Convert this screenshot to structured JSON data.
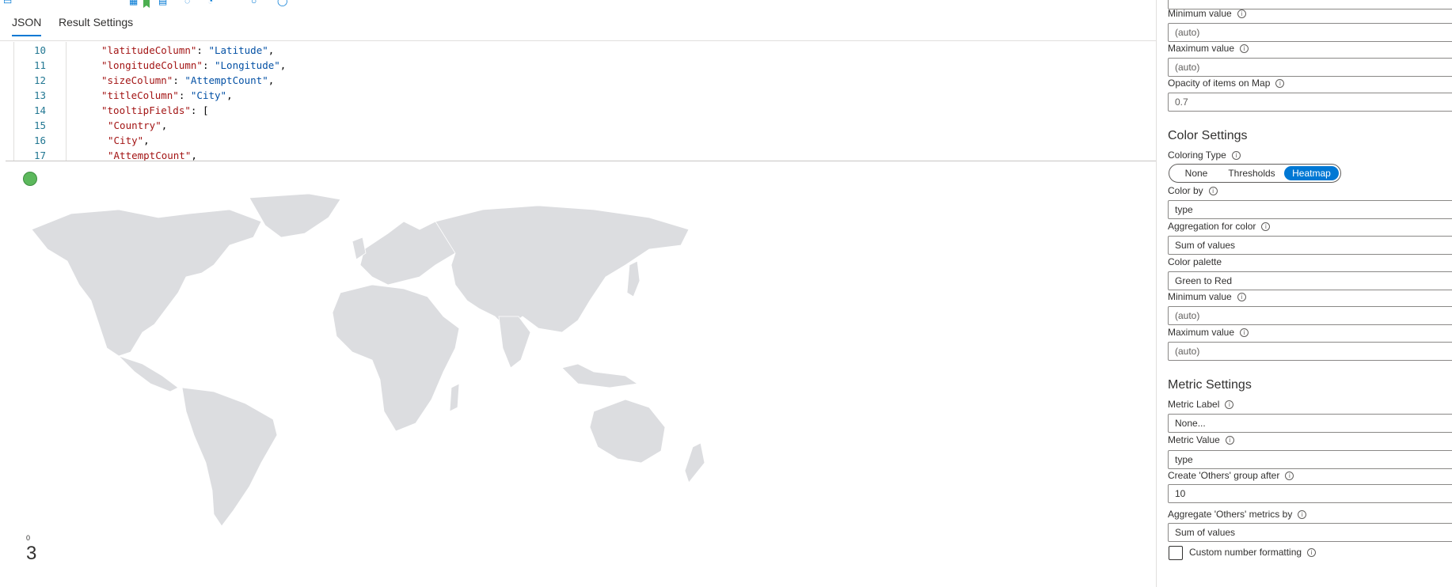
{
  "tabs": [
    "JSON",
    "Result Settings"
  ],
  "editor": {
    "lines": [
      {
        "num": "10",
        "key": "\"latitudeColumn\"",
        "value": "\"Latitude\"",
        "tail": ","
      },
      {
        "num": "11",
        "key": "\"longitudeColumn\"",
        "value": "\"Longitude\"",
        "tail": ","
      },
      {
        "num": "12",
        "key": "\"sizeColumn\"",
        "value": "\"AttemptCount\"",
        "tail": ","
      },
      {
        "num": "13",
        "key": "\"titleColumn\"",
        "value": "\"City\"",
        "tail": ","
      },
      {
        "num": "14",
        "key": "\"tooltipFields\"",
        "value": "",
        "tail": ": ["
      },
      {
        "num": "15",
        "key": "",
        "value": "\"Country\"",
        "tail": ","
      },
      {
        "num": "16",
        "key": "",
        "value": "\"City\"",
        "tail": ","
      },
      {
        "num": "17",
        "key": "",
        "value": "\"AttemptCount\"",
        "tail": ","
      }
    ]
  },
  "map_legend": {
    "small": "0",
    "big": "3"
  },
  "panel": {
    "size_min_label": "Minimum value",
    "size_min_value": "(auto)",
    "size_max_label": "Maximum value",
    "size_max_value": "(auto)",
    "opacity_label": "Opacity of items on Map",
    "opacity_value": "0.7",
    "color_section": "Color Settings",
    "coloring_type_label": "Coloring Type",
    "coloring_options": [
      "None",
      "Thresholds",
      "Heatmap"
    ],
    "coloring_selected": "Heatmap",
    "color_by_label": "Color by",
    "color_by_value": "type",
    "agg_color_label": "Aggregation for color",
    "agg_color_value": "Sum of values",
    "palette_label": "Color palette",
    "palette_value": "Green to Red",
    "color_min_label": "Minimum value",
    "color_min_value": "(auto)",
    "color_max_label": "Maximum value",
    "color_max_value": "(auto)",
    "metric_section": "Metric Settings",
    "metric_label_label": "Metric Label",
    "metric_label_value": "None...",
    "metric_value_label": "Metric Value",
    "metric_value_value": "type",
    "others_after_label": "Create 'Others' group after",
    "others_after_value": "10",
    "agg_others_label": "Aggregate 'Others' metrics by",
    "agg_others_value": "Sum of values",
    "custom_format_label": "Custom number formatting"
  },
  "icons": {
    "info": "info-circle-icon",
    "status": "status-dot-icon",
    "checkbox": "checkbox-icon"
  },
  "colors": {
    "accent": "#0078d4",
    "status_ok": "#5cb85c",
    "land": "#dcdde0"
  }
}
